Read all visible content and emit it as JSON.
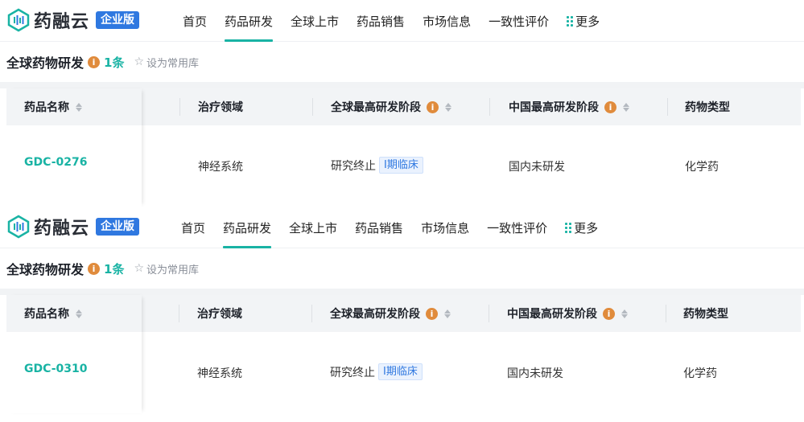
{
  "brand": {
    "name": "药融云",
    "badge": "企业版"
  },
  "nav": {
    "items": [
      "首页",
      "药品研发",
      "全球上市",
      "药品销售",
      "市场信息",
      "一致性评价"
    ],
    "more_label": "更多"
  },
  "section": {
    "title": "全球药物研发",
    "count": "1条",
    "fav_label": "设为常用库"
  },
  "table": {
    "headers": {
      "name": "药品名称",
      "area": "治疗领域",
      "global_stage": "全球最高研发阶段",
      "china_stage": "中国最高研发阶段",
      "drug_type": "药物类型"
    }
  },
  "records": [
    {
      "name": "GDC-0276",
      "area": "神经系统",
      "global_status": "研究终止",
      "global_phase": "Ⅰ期临床",
      "china_stage": "国内未研发",
      "drug_type": "化学药"
    },
    {
      "name": "GDC-0310",
      "area": "神经系统",
      "global_status": "研究终止",
      "global_phase": "Ⅰ期临床",
      "china_stage": "国内未研发",
      "drug_type": "化学药"
    }
  ],
  "colors": {
    "accent": "#19b3a4",
    "brand_blue": "#2f78e0",
    "hint": "#e08b3c"
  }
}
